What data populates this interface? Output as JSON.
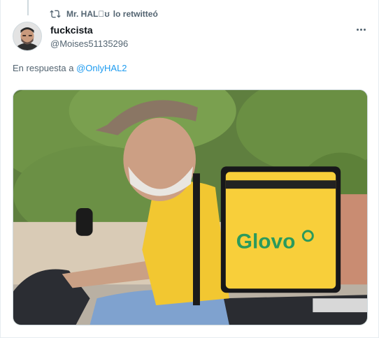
{
  "retweet": {
    "icon": "retweet-icon",
    "user": "Mr. HALʊ",
    "suffix": "lo retwitteó"
  },
  "tweet": {
    "display_name": "fuckcista",
    "handle": "@Moises51135296",
    "reply_prefix": "En respuesta a",
    "reply_to": "@OnlyHAL2",
    "more_icon": "more-icon"
  },
  "media": {
    "bag_text": "Glovo",
    "bag_color": "#f8cf3a",
    "bag_text_color": "#2b9a5c"
  }
}
